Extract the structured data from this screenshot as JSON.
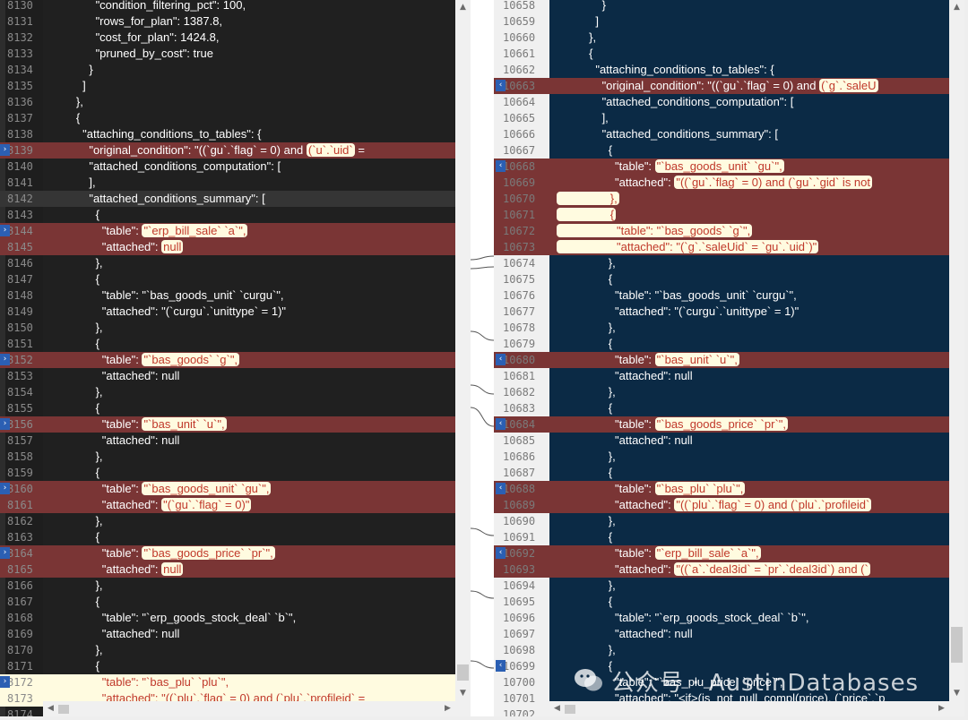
{
  "left_pane": {
    "lines": [
      {
        "num": "8130",
        "text": "              \"condition_filtering_pct\": 100,",
        "hl": ""
      },
      {
        "num": "8131",
        "text": "              \"rows_for_plan\": 1387.8,",
        "hl": ""
      },
      {
        "num": "8132",
        "text": "              \"cost_for_plan\": 1424.8,",
        "hl": ""
      },
      {
        "num": "8133",
        "text": "              \"pruned_by_cost\": true",
        "hl": ""
      },
      {
        "num": "8134",
        "text": "            }",
        "hl": ""
      },
      {
        "num": "8135",
        "text": "          ]",
        "hl": ""
      },
      {
        "num": "8136",
        "text": "        },",
        "hl": ""
      },
      {
        "num": "8137",
        "text": "        {",
        "hl": ""
      },
      {
        "num": "8138",
        "text": "          \"attaching_conditions_to_tables\": {",
        "hl": ""
      },
      {
        "num": "8139",
        "pre": "            \"original_condition\": \"((`gu`.`flag` = 0) and ",
        "chg": "(`u`.`uid`",
        "post": " = ",
        "hl": "red",
        "marker": true
      },
      {
        "num": "8140",
        "text": "            \"attached_conditions_computation\": [",
        "hl": ""
      },
      {
        "num": "8141",
        "text": "            ],",
        "hl": ""
      },
      {
        "num": "8142",
        "text": "            \"attached_conditions_summary\": [",
        "hl": "cur"
      },
      {
        "num": "8143",
        "text": "              {",
        "hl": ""
      },
      {
        "num": "8144",
        "pre": "                \"table\": ",
        "chg": "\"`erp_bill_sale` `a`\",",
        "post": "",
        "hl": "red",
        "marker": true
      },
      {
        "num": "8145",
        "pre": "                \"attached\": ",
        "chg": "null",
        "post": "",
        "hl": "red"
      },
      {
        "num": "8146",
        "text": "              },",
        "hl": ""
      },
      {
        "num": "8147",
        "text": "              {",
        "hl": ""
      },
      {
        "num": "8148",
        "text": "                \"table\": \"`bas_goods_unit` `curgu`\",",
        "hl": ""
      },
      {
        "num": "8149",
        "text": "                \"attached\": \"(`curgu`.`unittype` = 1)\"",
        "hl": ""
      },
      {
        "num": "8150",
        "text": "              },",
        "hl": ""
      },
      {
        "num": "8151",
        "text": "              {",
        "hl": ""
      },
      {
        "num": "8152",
        "pre": "                \"table\": ",
        "chg": "\"`bas_goods` `g`\",",
        "post": "",
        "hl": "red",
        "marker": true
      },
      {
        "num": "8153",
        "text": "                \"attached\": null",
        "hl": ""
      },
      {
        "num": "8154",
        "text": "              },",
        "hl": ""
      },
      {
        "num": "8155",
        "text": "              {",
        "hl": ""
      },
      {
        "num": "8156",
        "pre": "                \"table\": ",
        "chg": "\"`bas_unit` `u`\",",
        "post": "",
        "hl": "red",
        "marker": true
      },
      {
        "num": "8157",
        "text": "                \"attached\": null",
        "hl": ""
      },
      {
        "num": "8158",
        "text": "              },",
        "hl": ""
      },
      {
        "num": "8159",
        "text": "              {",
        "hl": ""
      },
      {
        "num": "8160",
        "pre": "                \"table\": ",
        "chg": "\"`bas_goods_unit` `gu`\",",
        "post": "",
        "hl": "red",
        "marker": true
      },
      {
        "num": "8161",
        "pre": "                \"attached\": ",
        "chg": "\"(`gu`.`flag` = 0)\"",
        "post": "",
        "hl": "red"
      },
      {
        "num": "8162",
        "text": "              },",
        "hl": ""
      },
      {
        "num": "8163",
        "text": "              {",
        "hl": ""
      },
      {
        "num": "8164",
        "pre": "                \"table\": ",
        "chg": "\"`bas_goods_price` `pr`\",",
        "post": "",
        "hl": "red",
        "marker": true
      },
      {
        "num": "8165",
        "pre": "                \"attached\": ",
        "chg": "null",
        "post": "",
        "hl": "red"
      },
      {
        "num": "8166",
        "text": "              },",
        "hl": ""
      },
      {
        "num": "8167",
        "text": "              {",
        "hl": ""
      },
      {
        "num": "8168",
        "text": "                \"table\": \"`erp_goods_stock_deal` `b`\",",
        "hl": ""
      },
      {
        "num": "8169",
        "text": "                \"attached\": null",
        "hl": ""
      },
      {
        "num": "8170",
        "text": "              },",
        "hl": ""
      },
      {
        "num": "8171",
        "text": "              {",
        "hl": ""
      },
      {
        "num": "8172",
        "text": "                \"table\": \"`bas_plu` `plu`\",",
        "hl": "yellow",
        "marker": true
      },
      {
        "num": "8173",
        "text": "                \"attached\": \"((`plu`.`flag` = 0) and (`plu`.`profileid` =",
        "hl": "yellow"
      },
      {
        "num": "8174",
        "text": "",
        "hl": ""
      }
    ]
  },
  "right_pane": {
    "lines": [
      {
        "num": "10658",
        "text": "              }",
        "hl": ""
      },
      {
        "num": "10659",
        "text": "            ]",
        "hl": ""
      },
      {
        "num": "10660",
        "text": "          },",
        "hl": ""
      },
      {
        "num": "10661",
        "text": "          {",
        "hl": ""
      },
      {
        "num": "10662",
        "text": "            \"attaching_conditions_to_tables\": {",
        "hl": ""
      },
      {
        "num": "10663",
        "pre": "              \"original_condition\": \"((`gu`.`flag` = 0) and ",
        "chg": "(`g`.`saleU",
        "post": "",
        "hl": "red",
        "marker": true
      },
      {
        "num": "10664",
        "text": "              \"attached_conditions_computation\": [",
        "hl": ""
      },
      {
        "num": "10665",
        "text": "              ],",
        "hl": ""
      },
      {
        "num": "10666",
        "text": "              \"attached_conditions_summary\": [",
        "hl": ""
      },
      {
        "num": "10667",
        "text": "                {",
        "hl": ""
      },
      {
        "num": "10668",
        "pre": "                  \"table\": ",
        "chg": "\"`bas_goods_unit` `gu`\",",
        "post": "",
        "hl": "red",
        "marker": true
      },
      {
        "num": "10669",
        "pre": "                  \"attached\": ",
        "chg": "\"((`gu`.`flag` = 0) and (`gu`.`gid` is not",
        "post": "",
        "hl": "red"
      },
      {
        "num": "10670",
        "pre": "",
        "chg": "                },",
        "post": "",
        "hl": "red"
      },
      {
        "num": "10671",
        "pre": "",
        "chg": "                {",
        "post": "",
        "hl": "red"
      },
      {
        "num": "10672",
        "pre": "",
        "chg": "                  \"table\": \"`bas_goods` `g`\",",
        "post": "",
        "hl": "red"
      },
      {
        "num": "10673",
        "pre": "",
        "chg": "                  \"attached\": \"(`g`.`saleUid` = `gu`.`uid`)\"",
        "post": "",
        "hl": "red"
      },
      {
        "num": "10674",
        "text": "                },",
        "hl": ""
      },
      {
        "num": "10675",
        "text": "                {",
        "hl": ""
      },
      {
        "num": "10676",
        "text": "                  \"table\": \"`bas_goods_unit` `curgu`\",",
        "hl": ""
      },
      {
        "num": "10677",
        "text": "                  \"attached\": \"(`curgu`.`unittype` = 1)\"",
        "hl": ""
      },
      {
        "num": "10678",
        "text": "                },",
        "hl": ""
      },
      {
        "num": "10679",
        "text": "                {",
        "hl": ""
      },
      {
        "num": "10680",
        "pre": "                  \"table\": ",
        "chg": "\"`bas_unit` `u`\",",
        "post": "",
        "hl": "red",
        "marker": true
      },
      {
        "num": "10681",
        "text": "                  \"attached\": null",
        "hl": ""
      },
      {
        "num": "10682",
        "text": "                },",
        "hl": ""
      },
      {
        "num": "10683",
        "text": "                {",
        "hl": ""
      },
      {
        "num": "10684",
        "pre": "                  \"table\": ",
        "chg": "\"`bas_goods_price` `pr`\",",
        "post": "",
        "hl": "red",
        "marker": true
      },
      {
        "num": "10685",
        "text": "                  \"attached\": null",
        "hl": ""
      },
      {
        "num": "10686",
        "text": "                },",
        "hl": ""
      },
      {
        "num": "10687",
        "text": "                {",
        "hl": ""
      },
      {
        "num": "10688",
        "pre": "                  \"table\": ",
        "chg": "\"`bas_plu` `plu`\",",
        "post": "",
        "hl": "red",
        "marker": true
      },
      {
        "num": "10689",
        "pre": "                  \"attached\": ",
        "chg": "\"((`plu`.`flag` = 0) and (`plu`.`profileid`",
        "post": "",
        "hl": "red"
      },
      {
        "num": "10690",
        "text": "                },",
        "hl": ""
      },
      {
        "num": "10691",
        "text": "                {",
        "hl": ""
      },
      {
        "num": "10692",
        "pre": "                  \"table\": ",
        "chg": "\"`erp_bill_sale` `a`\",",
        "post": "",
        "hl": "red",
        "marker": true
      },
      {
        "num": "10693",
        "pre": "                  \"attached\": ",
        "chg": "\"((`a`.`deal3id` = `pr`.`deal3id`) and (`",
        "post": "",
        "hl": "red"
      },
      {
        "num": "10694",
        "text": "                },",
        "hl": ""
      },
      {
        "num": "10695",
        "text": "                {",
        "hl": ""
      },
      {
        "num": "10696",
        "text": "                  \"table\": \"`erp_goods_stock_deal` `b`\",",
        "hl": ""
      },
      {
        "num": "10697",
        "text": "                  \"attached\": null",
        "hl": ""
      },
      {
        "num": "10698",
        "text": "                },",
        "hl": ""
      },
      {
        "num": "10699",
        "text": "                {",
        "hl": "",
        "marker": true
      },
      {
        "num": "10700",
        "text": "                  \"table\": \"`bas_plu_price` `price`\",",
        "hl": ""
      },
      {
        "num": "10701",
        "text": "                  \"attached\": \"<if>(is_not_null_compl(price), (`price`.`p",
        "hl": ""
      },
      {
        "num": "10702",
        "text": "",
        "hl": ""
      }
    ]
  },
  "watermark": {
    "text": "公众号 · AustinDatabases"
  },
  "colors": {
    "left_code_bg": "#202020",
    "right_code_bg": "#0b2a45",
    "change_line_bg": "#7a3535",
    "change_chip_bg": "#fffbe0",
    "change_chip_text": "#c0392b",
    "marker_blue": "#2b5fb3"
  }
}
